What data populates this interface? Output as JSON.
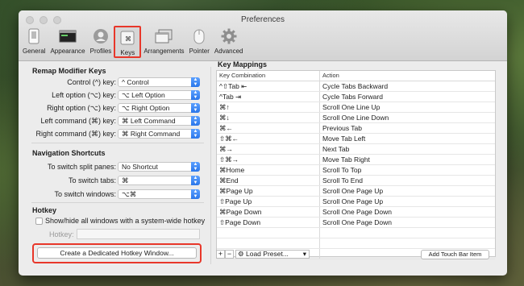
{
  "window": {
    "title": "Preferences"
  },
  "toolbar": [
    {
      "label": "General",
      "icon": "phone-icon"
    },
    {
      "label": "Appearance",
      "icon": "window-icon"
    },
    {
      "label": "Profiles",
      "icon": "person-icon"
    },
    {
      "label": "Keys",
      "icon": "keyboard-key-icon",
      "selected": true
    },
    {
      "label": "Arrangements",
      "icon": "windows-stack-icon"
    },
    {
      "label": "Pointer",
      "icon": "mouse-icon"
    },
    {
      "label": "Advanced",
      "icon": "gear-icon"
    }
  ],
  "remap": {
    "title": "Remap Modifier Keys",
    "rows": [
      {
        "label": "Control (^) key:",
        "value": "^ Control"
      },
      {
        "label": "Left option (⌥) key:",
        "value": "⌥ Left Option"
      },
      {
        "label": "Right option (⌥) key:",
        "value": "⌥ Right Option"
      },
      {
        "label": "Left command (⌘) key:",
        "value": "⌘ Left Command"
      },
      {
        "label": "Right command (⌘) key:",
        "value": "⌘ Right Command"
      }
    ]
  },
  "navigation": {
    "title": "Navigation Shortcuts",
    "rows": [
      {
        "label": "To switch split panes:",
        "value": "No Shortcut"
      },
      {
        "label": "To switch tabs:",
        "value": "⌘"
      },
      {
        "label": "To switch windows:",
        "value": "⌥⌘"
      }
    ]
  },
  "hotkey": {
    "title": "Hotkey",
    "checkbox_label": "Show/hide all windows with a system-wide hotkey",
    "field_label": "Hotkey:",
    "field_value": "",
    "button_label": "Create a Dedicated Hotkey Window..."
  },
  "mappings": {
    "title": "Key Mappings",
    "headers": [
      "Key Combination",
      "Action"
    ],
    "rows": [
      [
        "^⇧Tab ⇤",
        "Cycle Tabs Backward"
      ],
      [
        "^Tab ⇥",
        "Cycle Tabs Forward"
      ],
      [
        "⌘↑",
        "Scroll One Line Up"
      ],
      [
        "⌘↓",
        "Scroll One Line Down"
      ],
      [
        "⌘←",
        "Previous Tab"
      ],
      [
        "⇧⌘←",
        "Move Tab Left"
      ],
      [
        "⌘→",
        "Next Tab"
      ],
      [
        "⇧⌘→",
        "Move Tab Right"
      ],
      [
        "⌘Home",
        "Scroll To Top"
      ],
      [
        "⌘End",
        "Scroll To End"
      ],
      [
        "⌘Page Up",
        "Scroll One Page Up"
      ],
      [
        "⇧Page Up",
        "Scroll One Page Up"
      ],
      [
        "⌘Page Down",
        "Scroll One Page Down"
      ],
      [
        "⇧Page Down",
        "Scroll One Page Down"
      ]
    ],
    "add_label": "+",
    "remove_label": "−",
    "load_preset_label": "Load Preset...",
    "touchbar_label": "Add Touch Bar Item"
  },
  "colors": {
    "accent": "#2a76ea",
    "highlight": "#e8372a"
  }
}
